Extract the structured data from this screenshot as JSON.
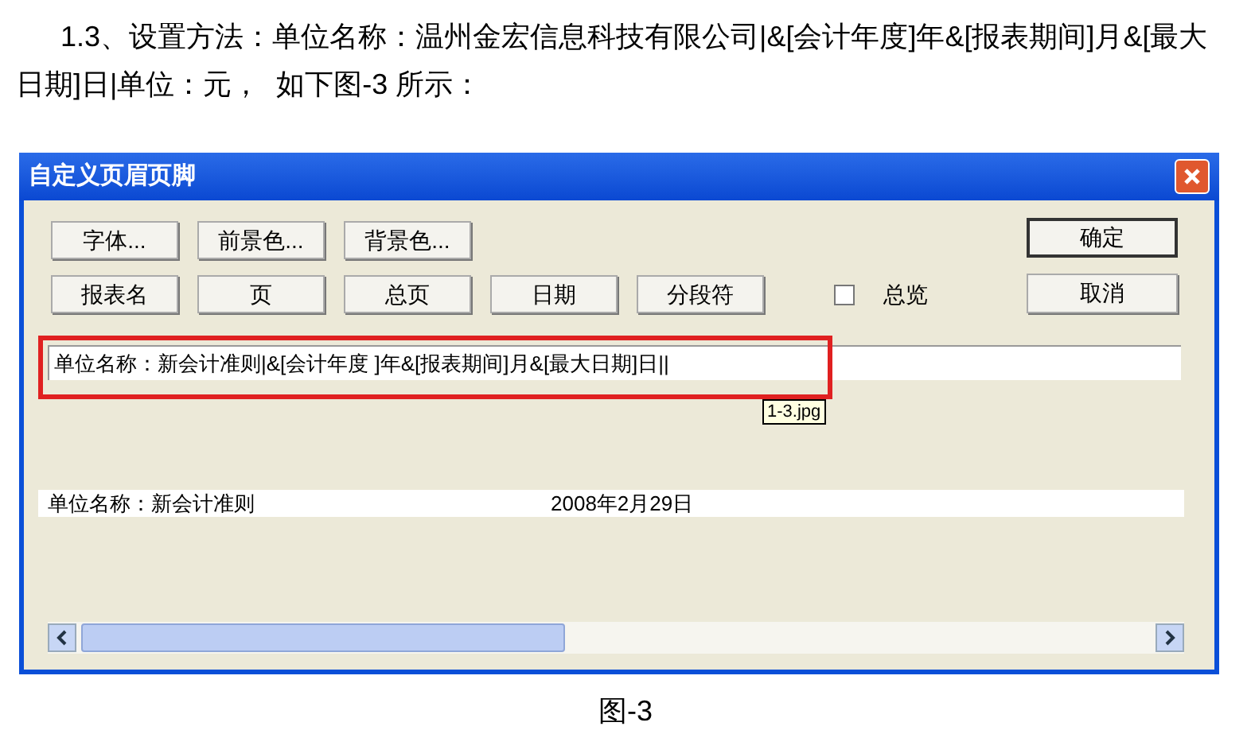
{
  "paragraph": "1.3、设置方法：单位名称：温州金宏信息科技有限公司|&[会计年度]年&[报表期间]月&[最大日期]日|单位：元，  如下图-3 所示：",
  "dialog": {
    "title": "自定义页眉页脚",
    "format_buttons": [
      "字体...",
      "前景色...",
      "背景色..."
    ],
    "insert_buttons": [
      "报表名",
      "页",
      "总页",
      "日期",
      "分段符"
    ],
    "overview": {
      "label": "总览",
      "checked": false
    },
    "ok_button": "确定",
    "cancel_button": "取消",
    "header_field": {
      "value": "单位名称：新会计准则|&[会计年度 ]年&[报表期间]月&[最大日期]日||"
    },
    "tooltip": "1-3.jpg",
    "preview": {
      "left": "单位名称：新会计准则",
      "center": "2008年2月29日"
    }
  },
  "caption": "图-3"
}
